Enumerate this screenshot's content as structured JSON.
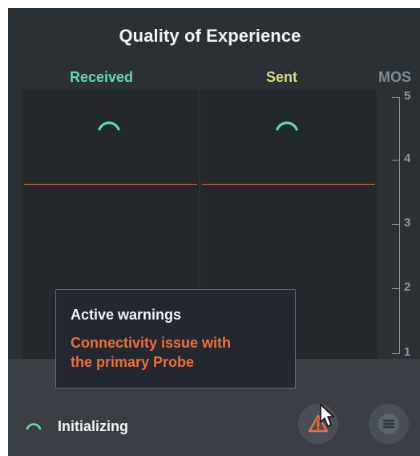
{
  "header": {
    "title": "Quality of Experience"
  },
  "columns": {
    "received": "Received",
    "sent": "Sent",
    "mos": "MOS"
  },
  "axis": {
    "ticks": [
      "5",
      "4",
      "3",
      "2",
      "1"
    ]
  },
  "status": {
    "text": "Initializing"
  },
  "tooltip": {
    "title": "Active warnings",
    "message_line1": "Connectivity issue with",
    "message_line2": "the primary Probe"
  },
  "colors": {
    "received": "#62d9ad",
    "sent": "#d8d884",
    "threshold": "#e0703c",
    "warning": "#f06f3b"
  },
  "icons": {
    "warning": "warning-triangle-icon",
    "menu": "hamburger-menu-icon"
  }
}
